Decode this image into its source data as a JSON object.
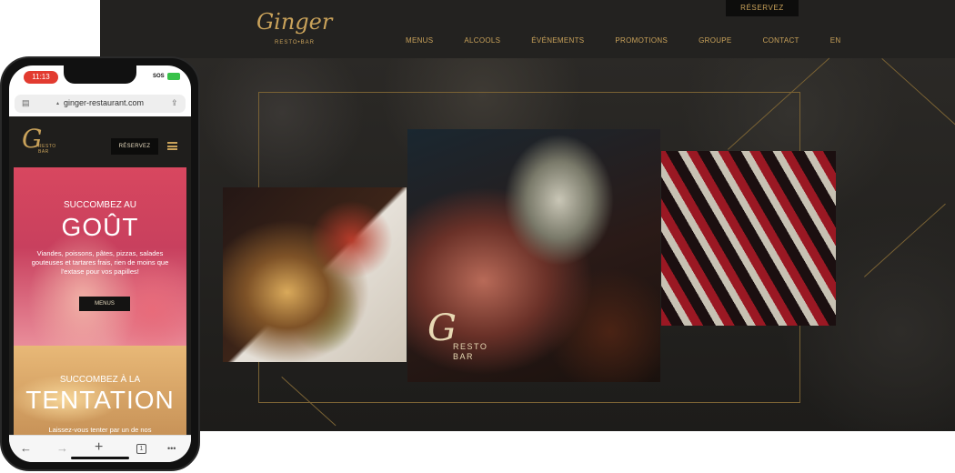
{
  "desktop": {
    "logo": {
      "script": "Ginger",
      "sub": "RESTO•BAR"
    },
    "reserve_label": "RÉSERVEZ",
    "nav": [
      "MENUS",
      "ALCOOLS",
      "ÉVÉNEMENTS",
      "PROMOTIONS",
      "GROUPE",
      "CONTACT",
      "EN"
    ],
    "photo_logo": {
      "script": "G",
      "sub_line1": "RESTO",
      "sub_line2": "BAR"
    }
  },
  "phone": {
    "time": "11:13",
    "sos": "SOS",
    "url": "ginger-restaurant.com",
    "header": {
      "logo": {
        "script": "G",
        "sub_line1": "RESTO",
        "sub_line2": "BAR"
      },
      "reserve_label": "RÉSERVEZ"
    },
    "card1": {
      "kicker": "SUCCOMBEZ AU",
      "title": "GOÛT",
      "text": "Viandes, poissons, pâtes, pizzas, salades gouteuses et tartares frais, rien de moins que l'extase pour vos papilles!",
      "button": "MENUS"
    },
    "card2": {
      "kicker": "SUCCOMBEZ À LA",
      "title": "TENTATION",
      "text": "Laissez-vous tenter par un de nos"
    },
    "toolbar": {
      "back": "←",
      "forward": "→",
      "new_tab": "+",
      "tabs": "1",
      "more": "•••"
    }
  },
  "colors": {
    "gold": "#c9a25a",
    "dark_bg": "#1e1d1b",
    "pink": "#d8475f"
  }
}
